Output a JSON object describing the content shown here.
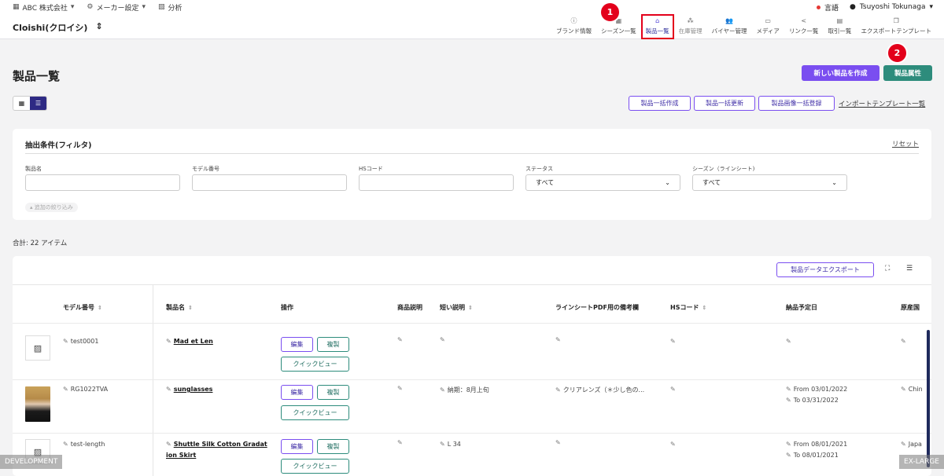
{
  "topbar": {
    "company": "ABC 株式会社",
    "maker": "メーカー設定",
    "analysis": "分析",
    "language": "言語",
    "user": "Tsuyoshi Tokunaga"
  },
  "navbar": {
    "brand": "Cloishi(クロイシ)",
    "items": [
      {
        "label": "ブランド情報",
        "icon": "info-icon"
      },
      {
        "label": "シーズン一覧",
        "icon": "grid-icon"
      },
      {
        "label": "製品一覧",
        "icon": "hanger-icon"
      },
      {
        "label": "在庫管理",
        "icon": "boxes-icon"
      },
      {
        "label": "バイヤー管理",
        "icon": "people-icon"
      },
      {
        "label": "メディア",
        "icon": "cast-icon"
      },
      {
        "label": "リンク一覧",
        "icon": "share-icon"
      },
      {
        "label": "取引一覧",
        "icon": "receipt-icon"
      },
      {
        "label": "エクスポートテンプレート",
        "icon": "copy-icon"
      }
    ]
  },
  "annotations": {
    "one": "1",
    "two": "2"
  },
  "page": {
    "title": "製品一覧",
    "new_product": "新しい製品を作成",
    "attributes": "製品属性",
    "bulk_create": "製品一括作成",
    "bulk_update": "製品一括更新",
    "bulk_image": "製品画像一括登録",
    "import_templates": "インポートテンプレート一覧"
  },
  "filter": {
    "title": "抽出条件(フィルタ)",
    "reset": "リセット",
    "fields": [
      {
        "label": "製品名",
        "value": ""
      },
      {
        "label": "モデル番号",
        "value": ""
      },
      {
        "label": "HSコード",
        "value": ""
      },
      {
        "label": "ステータス",
        "value": "すべて"
      },
      {
        "label": "シーズン（ラインシート)",
        "value": "すべて"
      }
    ],
    "extra": "追加の絞り込み"
  },
  "total": "合計:  22 アイテム",
  "table": {
    "export": "製品データエクスポート",
    "headers": [
      "モデル番号",
      "製品名",
      "操作",
      "商品説明",
      "短い説明",
      "ラインシートPDF用の備考欄",
      "HSコード",
      "納品予定日",
      "原産国"
    ],
    "edit_label": "編集",
    "copy_label": "複製",
    "quick_label": "クイックビュー",
    "rows": [
      {
        "model": "test0001",
        "name": "Mad et Len",
        "name2": "",
        "short": "",
        "note": "",
        "date1": "",
        "date2": "",
        "origin": ""
      },
      {
        "model": "RG1022TVA",
        "name": "sunglasses",
        "name2": "",
        "short": "納期：8月上旬",
        "note": "クリアレンズ（＊少し色の...",
        "date1": "From 03/01/2022",
        "date2": "To 03/31/2022",
        "origin": "Chin"
      },
      {
        "model": "test-length",
        "name": "Shuttle Silk Cotton Gradat",
        "name2": "ion Skirt",
        "short": "L 34",
        "note": "",
        "date1": "From 08/01/2021",
        "date2": "To 08/01/2021",
        "origin": "Japa"
      }
    ]
  },
  "corners": {
    "left": "DEVELOPMENT",
    "right": "EX-LARGE"
  }
}
